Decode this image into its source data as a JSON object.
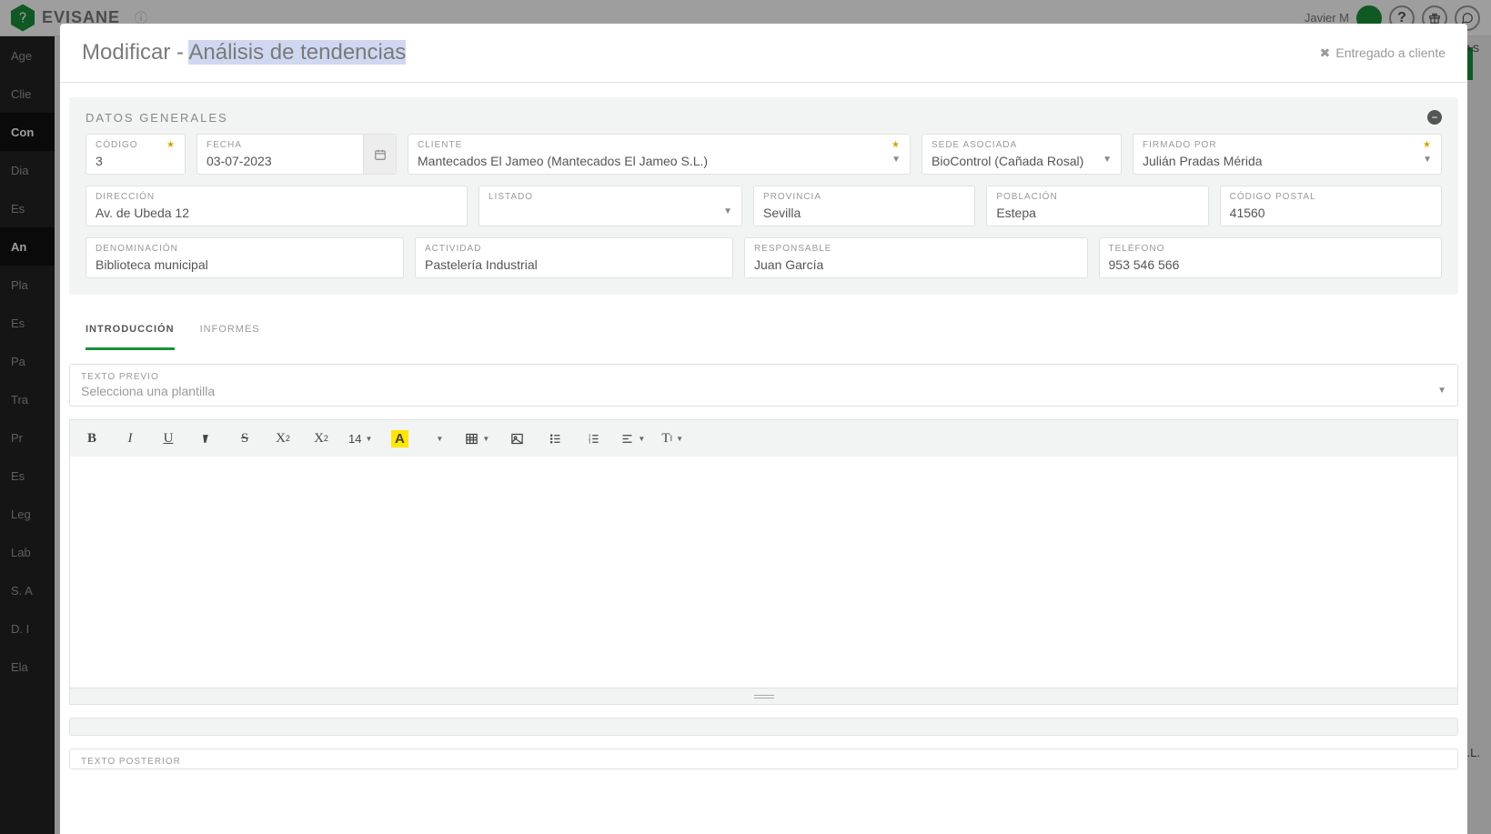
{
  "top": {
    "brand": "EVISANE",
    "user": "Javier M"
  },
  "sidebar": {
    "items": [
      "Age",
      "Clie",
      "Con",
      "Dia",
      "Es",
      "An",
      "Pla",
      "Es",
      "Pa",
      "Tra",
      "Pr",
      "Es",
      "Leg",
      "Lab",
      "S. A",
      "D. I",
      "Ela"
    ]
  },
  "page": {
    "rightlink": "IAS",
    "rowtext": "S.L."
  },
  "modal": {
    "title_pre": "Modificar - ",
    "title_hl": "Análisis de tendencias",
    "deliver_label": "Entregado a cliente",
    "panel_title": "DATOS GENERALES",
    "codigo": {
      "label": "CÓDIGO",
      "value": "3"
    },
    "fecha": {
      "label": "FECHA",
      "value": "03-07-2023"
    },
    "cliente": {
      "label": "CLIENTE",
      "value": "Mantecados El Jameo (Mantecados El Jameo S.L.)"
    },
    "sede": {
      "label": "SEDE ASOCIADA",
      "value": "BioControl (Cañada Rosal)"
    },
    "firmado": {
      "label": "FIRMADO POR",
      "value": "Julián Pradas Mérida"
    },
    "direccion": {
      "label": "DIRECCIÓN",
      "value": "Av. de Ubeda 12"
    },
    "listado": {
      "label": "LISTADO",
      "value": ""
    },
    "provincia": {
      "label": "PROVINCIA",
      "value": "Sevilla"
    },
    "poblacion": {
      "label": "POBLACIÓN",
      "value": "Estepa"
    },
    "cp": {
      "label": "CÓDIGO POSTAL",
      "value": "41560"
    },
    "denom": {
      "label": "DENOMINACIÓN",
      "value": "Biblioteca municipal"
    },
    "actividad": {
      "label": "ACTIVIDAD",
      "value": "Pastelería Industrial"
    },
    "responsable": {
      "label": "RESPONSABLE",
      "value": "Juan García"
    },
    "telefono": {
      "label": "TELÉFONO",
      "value": "953 546 566"
    },
    "tabs": {
      "intro": "INTRODUCCIÓN",
      "informes": "INFORMES"
    },
    "texto_previo": {
      "label": "TEXTO PREVIO",
      "placeholder": "Selecciona una plantilla"
    },
    "font_size": "14",
    "texto_posterior_label": "TEXTO POSTERIOR"
  }
}
